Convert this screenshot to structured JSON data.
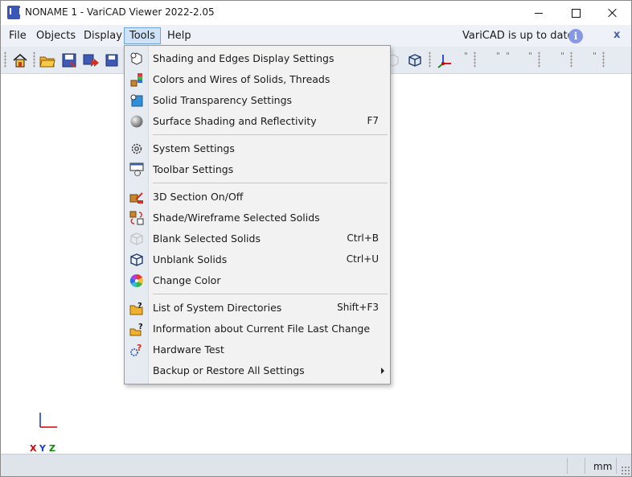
{
  "window": {
    "title": "NONAME 1 - VariCAD Viewer 2022-2.05"
  },
  "menubar": {
    "items": [
      {
        "label": "File"
      },
      {
        "label": "Objects"
      },
      {
        "label": "Display"
      },
      {
        "label": "Tools"
      },
      {
        "label": "Help"
      }
    ],
    "active": "Tools",
    "update_status": "VariCAD is up to date",
    "info_glyph": "i",
    "dismiss_glyph": "x"
  },
  "toolbar": {
    "ticks": [
      "\"",
      "\"",
      "\"",
      "\"",
      "\"",
      "\""
    ]
  },
  "tools_menu": {
    "items": [
      {
        "label": "Shading and Edges Display Settings",
        "shortcut": "",
        "icon": "shading-icon"
      },
      {
        "label": "Colors and Wires of Solids, Threads",
        "shortcut": "",
        "icon": "colors-icon"
      },
      {
        "label": "Solid Transparency Settings",
        "shortcut": "",
        "icon": "transparency-icon"
      },
      {
        "label": "Surface Shading and Reflectivity",
        "shortcut": "F7",
        "icon": "sphere-icon"
      },
      {
        "label": "System Settings",
        "shortcut": "",
        "icon": "gear-icon"
      },
      {
        "label": "Toolbar Settings",
        "shortcut": "",
        "icon": "toolbar-settings-icon"
      },
      {
        "label": "3D Section On/Off",
        "shortcut": "",
        "icon": "section-icon"
      },
      {
        "label": "Shade/Wireframe Selected Solids",
        "shortcut": "",
        "icon": "shade-wireframe-icon"
      },
      {
        "label": "Blank Selected Solids",
        "shortcut": "Ctrl+B",
        "icon": "blank-cube-icon"
      },
      {
        "label": "Unblank Solids",
        "shortcut": "Ctrl+U",
        "icon": "cube-icon"
      },
      {
        "label": "Change Color",
        "shortcut": "",
        "icon": "color-wheel-icon"
      },
      {
        "label": "List of System Directories",
        "shortcut": "Shift+F3",
        "icon": "folder-question-icon"
      },
      {
        "label": "Information about Current File Last Change",
        "shortcut": "",
        "icon": "folder-info-icon"
      },
      {
        "label": "Hardware Test",
        "shortcut": "",
        "icon": "hardware-test-icon"
      },
      {
        "label": "Backup or Restore All Settings",
        "shortcut": "",
        "icon": "backup-icon",
        "submenu": true
      }
    ]
  },
  "axes": {
    "x": "X",
    "y": "Y",
    "z": "Z",
    "x_color": "#d40000",
    "y_color": "#1a3fd4",
    "z_color": "#0a8a0a"
  },
  "statusbar": {
    "unit": "mm"
  },
  "colors": {
    "menu_highlight": "#cfe2f7",
    "menu_strip": "#e6ebf2",
    "info_badge": "#8799e6"
  }
}
